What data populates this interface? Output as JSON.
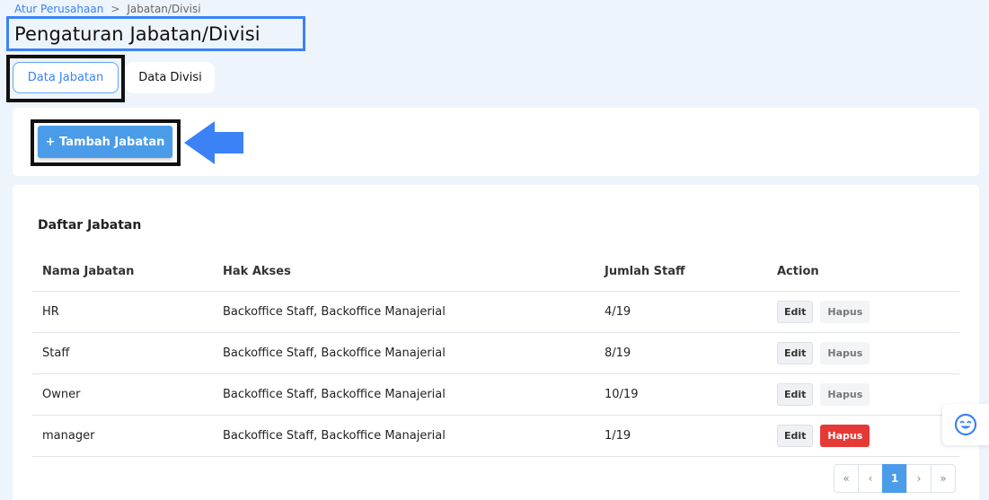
{
  "breadcrumb": {
    "parent": "Atur Perusahaan",
    "separator": ">",
    "current": "Jabatan/Divisi"
  },
  "page_title": "Pengaturan Jabatan/Divisi",
  "tabs": [
    {
      "label": "Data Jabatan",
      "active": true
    },
    {
      "label": "Data Divisi",
      "active": false
    }
  ],
  "add_button_label": "+ Tambah Jabatan",
  "section_title": "Daftar Jabatan",
  "table": {
    "headers": [
      "Nama Jabatan",
      "Hak Akses",
      "Jumlah Staff",
      "Action"
    ],
    "rows": [
      {
        "name": "HR",
        "access": "Backoffice Staff, Backoffice Manajerial",
        "staff": "4/19",
        "edit": "Edit",
        "delete": "Hapus"
      },
      {
        "name": "Staff",
        "access": "Backoffice Staff, Backoffice Manajerial",
        "staff": "8/19",
        "edit": "Edit",
        "delete": "Hapus"
      },
      {
        "name": "Owner",
        "access": "Backoffice Staff, Backoffice Manajerial",
        "staff": "10/19",
        "edit": "Edit",
        "delete": "Hapus"
      },
      {
        "name": "manager",
        "access": "Backoffice Staff, Backoffice Manajerial",
        "staff": "1/19",
        "edit": "Edit",
        "delete": "Hapus"
      }
    ]
  },
  "pagination": {
    "first": "«",
    "prev": "‹",
    "current": "1",
    "next": "›",
    "last": "»"
  },
  "colors": {
    "accent": "#4b9ce8",
    "link": "#3b82f6",
    "danger": "#e53935",
    "background": "#eef4fb"
  },
  "icons": {
    "arrow": "arrow-left-icon",
    "help": "smiley-face-icon"
  }
}
